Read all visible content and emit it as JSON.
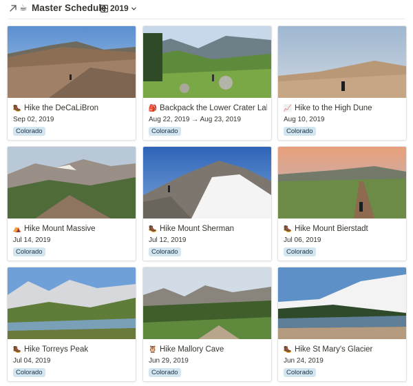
{
  "header": {
    "emoji": "☕",
    "title": "Master Schedule",
    "view_label": "2019"
  },
  "colors": {
    "tag_bg": "#d3e5ef",
    "tag_text": "#183347",
    "border": "#e3e2e0"
  },
  "cards": [
    {
      "emoji": "🥾",
      "emoji_name": "hiking-boot-icon",
      "title": "Hike the DeCaLiBron",
      "date": "Sep 02, 2019",
      "tag": "Colorado"
    },
    {
      "emoji": "🎒",
      "emoji_name": "backpack-icon",
      "title": "Backpack the Lower Crater Lakes",
      "date": "Aug 22, 2019 → Aug 23, 2019",
      "tag": "Colorado"
    },
    {
      "emoji": "📈",
      "emoji_name": "chart-increasing-icon",
      "title": "Hike to the High Dune",
      "date": "Aug 10, 2019",
      "tag": "Colorado"
    },
    {
      "emoji": "⛺",
      "emoji_name": "tent-icon",
      "title": "Hike Mount Massive",
      "date": "Jul 14, 2019",
      "tag": "Colorado"
    },
    {
      "emoji": "🥾",
      "emoji_name": "hiking-boot-icon",
      "title": "Hike Mount Sherman",
      "date": "Jul 12, 2019",
      "tag": "Colorado"
    },
    {
      "emoji": "🥾",
      "emoji_name": "hiking-boot-icon",
      "title": "Hike Mount Bierstadt",
      "date": "Jul 06, 2019",
      "tag": "Colorado"
    },
    {
      "emoji": "🥾",
      "emoji_name": "hiking-boot-icon",
      "title": "Hike Torreys Peak",
      "date": "Jul 04, 2019",
      "tag": "Colorado"
    },
    {
      "emoji": "🦉",
      "emoji_name": "owl-icon",
      "title": "Hike Mallory Cave",
      "date": "Jun 29, 2019",
      "tag": "Colorado"
    },
    {
      "emoji": "🥾",
      "emoji_name": "hiking-boot-icon",
      "title": "Hike St Mary's Glacier",
      "date": "Jun 24, 2019",
      "tag": "Colorado"
    }
  ]
}
